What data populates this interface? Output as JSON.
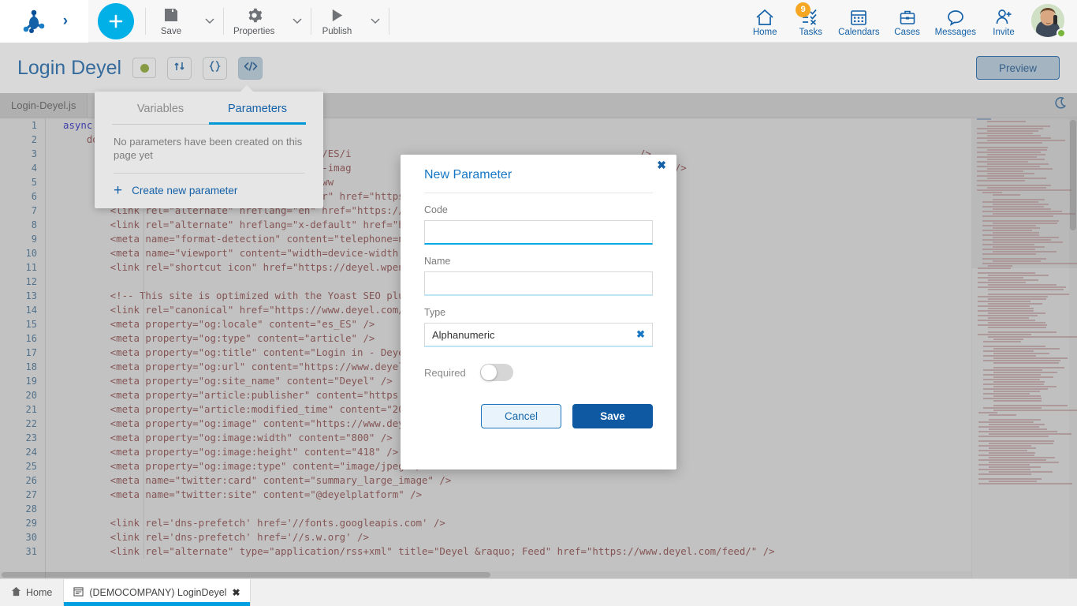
{
  "toolbar": {
    "logo_icon": "deyel-logo-icon",
    "expand_icon": "chevron-right-icon",
    "add_label": "+",
    "items": [
      {
        "label": "Save",
        "icon": "floppy-disk-icon"
      },
      {
        "label": "Properties",
        "icon": "gear-icon"
      },
      {
        "label": "Publish",
        "icon": "play-triangle-icon"
      }
    ],
    "right_items": [
      {
        "label": "Home",
        "icon": "home-icon",
        "badge": ""
      },
      {
        "label": "Tasks",
        "icon": "tasks-checklist-icon",
        "badge": "9"
      },
      {
        "label": "Calendars",
        "icon": "calendar-icon",
        "badge": ""
      },
      {
        "label": "Cases",
        "icon": "briefcase-icon",
        "badge": ""
      },
      {
        "label": "Messages",
        "icon": "speech-bubble-icon",
        "badge": ""
      },
      {
        "label": "Invite",
        "icon": "person-add-icon",
        "badge": ""
      }
    ],
    "avatar_icon": "user-avatar",
    "status_color": "#79b63d"
  },
  "page_header": {
    "title": "Login Deyel",
    "state_dot_color": "#8aa62a",
    "buttons": [
      {
        "icon": "flow-arrows-icon",
        "active": false
      },
      {
        "icon": "curly-braces-icon",
        "active": false
      },
      {
        "icon": "code-tags-icon",
        "active": true
      }
    ],
    "preview_label": "Preview"
  },
  "editor_tabs": {
    "file_tab": "Login-Deyel.js",
    "theme_toggle_icon": "moon-icon"
  },
  "popover": {
    "tabs": [
      {
        "label": "Variables",
        "selected": false
      },
      {
        "label": "Parameters",
        "selected": true
      }
    ],
    "empty_message": "No parameters have been created on this page yet",
    "create_label": "Create new parameter",
    "create_icon": "plus-icon"
  },
  "modal": {
    "title": "New Parameter",
    "close_icon": "close-icon",
    "code_label": "Code",
    "code_value": "",
    "name_label": "Name",
    "name_value": "",
    "type_label": "Type",
    "type_value": "Alphanumeric",
    "type_clear_icon": "clear-x-icon",
    "required_label": "Required",
    "required_on": false,
    "cancel_label": "Cancel",
    "save_label": "Save",
    "accent_color": "#1777c4",
    "save_bg": "#0e59a2"
  },
  "code": {
    "lines": [
      {
        "n": "1",
        "text": "async",
        "first": true
      },
      {
        "n": "2",
        "text": "    do"
      },
      {
        "n": "3",
        "text": "                                    'default/ES/i                                                 />"
      },
      {
        "n": "4",
        "text": "                                    low, max-imag                                                 w:-1' />"
      },
      {
        "n": "5",
        "text": "                                  =\"https://ww"
      },
      {
        "n": "6",
        "text": "        <link rel=\"alternate\" hreflang=\"pt-br\" href=\"https:/"
      },
      {
        "n": "7",
        "text": "        <link rel=\"alternate\" hreflang=\"en\" href=\"https://ww"
      },
      {
        "n": "8",
        "text": "        <link rel=\"alternate\" hreflang=\"x-default\" href=\"htt"
      },
      {
        "n": "9",
        "text": "        <meta name=\"format-detection\" content=\"telephone=no\""
      },
      {
        "n": "10",
        "text": "        <meta name=\"viewport\" content=\"width=device-width, i"
      },
      {
        "n": "11",
        "text": "        <link rel=\"shortcut icon\" href=\"https://deyel.wpengi                    type=\"image/x-icon\" />"
      },
      {
        "n": "12",
        "text": ""
      },
      {
        "n": "13",
        "text": "        <!-- This site is optimized with the Yoast SEO plugi                                     / -->"
      },
      {
        "n": "14",
        "text": "        <link rel=\"canonical\" href=\"https://www.deyel.com/lo"
      },
      {
        "n": "15",
        "text": "        <meta property=\"og:locale\" content=\"es_ES\" />"
      },
      {
        "n": "16",
        "text": "        <meta property=\"og:type\" content=\"article\" />"
      },
      {
        "n": "17",
        "text": "        <meta property=\"og:title\" content=\"Login in - Deyel\""
      },
      {
        "n": "18",
        "text": "        <meta property=\"og:url\" content=\"https://www.deyel.c"
      },
      {
        "n": "19",
        "text": "        <meta property=\"og:site_name\" content=\"Deyel\" />"
      },
      {
        "n": "20",
        "text": "        <meta property=\"article:publisher\" content=\"https://"
      },
      {
        "n": "21",
        "text": "        <meta property=\"article:modified_time\" content=\"2021"
      },
      {
        "n": "22",
        "text": "        <meta property=\"og:image\" content=\"https://www.deyel                 -medios.jpg\" />"
      },
      {
        "n": "23",
        "text": "        <meta property=\"og:image:width\" content=\"800\" />"
      },
      {
        "n": "24",
        "text": "        <meta property=\"og:image:height\" content=\"418\" />"
      },
      {
        "n": "25",
        "text": "        <meta property=\"og:image:type\" content=\"image/jpeg\" />"
      },
      {
        "n": "26",
        "text": "        <meta name=\"twitter:card\" content=\"summary_large_image\" />"
      },
      {
        "n": "27",
        "text": "        <meta name=\"twitter:site\" content=\"@deyelplatform\" />"
      },
      {
        "n": "28",
        "text": ""
      },
      {
        "n": "29",
        "text": "        <link rel='dns-prefetch' href='//fonts.googleapis.com' />"
      },
      {
        "n": "30",
        "text": "        <link rel='dns-prefetch' href='//s.w.org' />"
      },
      {
        "n": "31",
        "text": "        <link rel=\"alternate\" type=\"application/rss+xml\" title=\"Deyel &raquo; Feed\" href=\"https://www.deyel.com/feed/\" />"
      }
    ]
  },
  "taskbar": {
    "home_label": "Home",
    "home_icon": "home-solid-icon",
    "task_label": "(DEMOCOMPANY) LoginDeyel",
    "task_icon": "window-icon",
    "task_close_icon": "close-icon"
  }
}
